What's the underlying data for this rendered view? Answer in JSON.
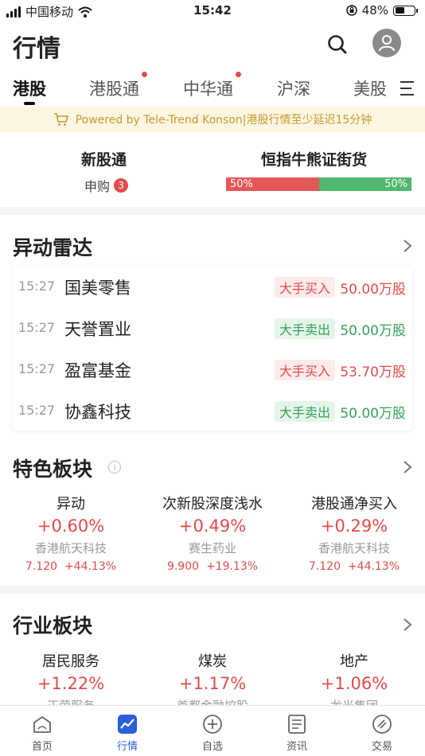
{
  "status_bar": {
    "carrier": "中国移动",
    "time": "15:42",
    "battery": "48%",
    "battery_level": 0.48
  },
  "header": {
    "title": "行情"
  },
  "tabs": [
    {
      "label": "港股",
      "active": true,
      "dot": false
    },
    {
      "label": "港股通",
      "active": false,
      "dot": true
    },
    {
      "label": "中华通",
      "active": false,
      "dot": true
    },
    {
      "label": "沪深",
      "active": false,
      "dot": false
    },
    {
      "label": "美股",
      "active": false,
      "dot": false
    }
  ],
  "notice": {
    "text": "Powered by Tele-Trend Konson|港股行情至少延迟15分钟"
  },
  "ipo": {
    "title": "新股通",
    "subscribe_label": "申购",
    "subscribe_count": "3",
    "bull_bear_title": "恒指牛熊证街货",
    "bull_pct": "50%",
    "bear_pct": "50%",
    "bull_share": 0.5
  },
  "radar": {
    "title": "异动雷达",
    "rows": [
      {
        "time": "15:27",
        "name": "国美零售",
        "tag": "大手买入",
        "volume": "50.00万股",
        "direction": "buy"
      },
      {
        "time": "15:27",
        "name": "天誉置业",
        "tag": "大手卖出",
        "volume": "50.00万股",
        "direction": "sell"
      },
      {
        "time": "15:27",
        "name": "盈富基金",
        "tag": "大手买入",
        "volume": "53.70万股",
        "direction": "buy"
      },
      {
        "time": "15:27",
        "name": "协鑫科技",
        "tag": "大手卖出",
        "volume": "50.00万股",
        "direction": "sell"
      }
    ]
  },
  "featured": {
    "title": "特色板块",
    "info_icon": "i",
    "cards": [
      {
        "name": "异动",
        "pct": "+0.60%",
        "stock": "香港航天科技",
        "price": "7.120",
        "change": "+44.13%"
      },
      {
        "name": "次新股深度浅水",
        "pct": "+0.49%",
        "stock": "赛生药业",
        "price": "9.900",
        "change": "+19.13%"
      },
      {
        "name": "港股通净买入",
        "pct": "+0.29%",
        "stock": "香港航天科技",
        "price": "7.120",
        "change": "+44.13%"
      }
    ]
  },
  "industry": {
    "title": "行业板块",
    "cards": [
      {
        "name": "居民服务",
        "pct": "+1.22%",
        "stock": "正荣服务"
      },
      {
        "name": "煤炭",
        "pct": "+1.17%",
        "stock": "首都金融控股"
      },
      {
        "name": "地产",
        "pct": "+1.06%",
        "stock": "龙光集团"
      }
    ]
  },
  "bottom_nav": [
    {
      "label": "首页",
      "icon": "home-icon",
      "active": false
    },
    {
      "label": "行情",
      "icon": "chart-icon",
      "active": true
    },
    {
      "label": "自选",
      "icon": "add-circle-icon",
      "active": false
    },
    {
      "label": "资讯",
      "icon": "news-icon",
      "active": false
    },
    {
      "label": "交易",
      "icon": "trade-icon",
      "active": false
    }
  ],
  "colors": {
    "up": "#e04b4b",
    "down": "#35a159",
    "accent": "#2a5fd8",
    "notice_bg": "#fcf6e3"
  }
}
